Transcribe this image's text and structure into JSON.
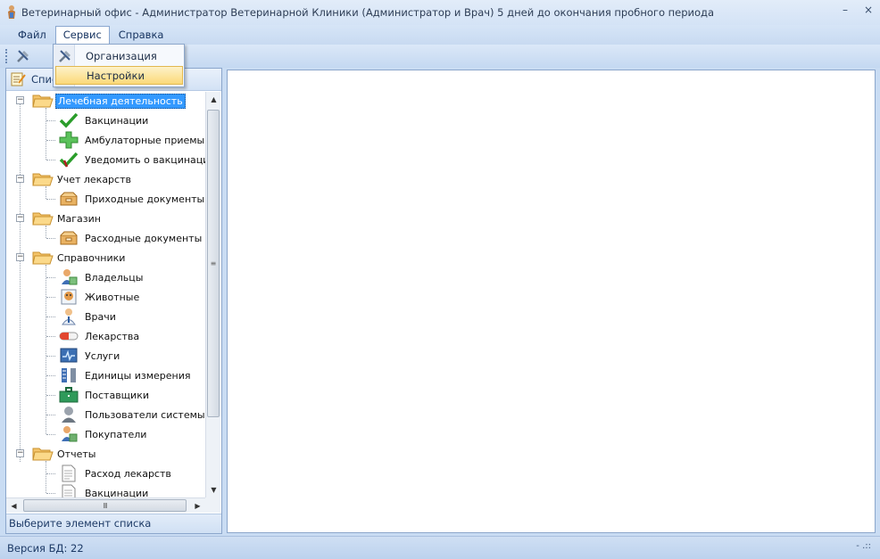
{
  "window": {
    "title": "Ветеринарный офис - Администратор Ветеринарной Клиники (Администратор и Врач) 5 дней до окончания пробного периода",
    "minimize": "–",
    "close": "×"
  },
  "menu": {
    "file": "Файл",
    "service": "Сервис",
    "help": "Справка"
  },
  "dropdown": {
    "items": [
      {
        "label": "Организация",
        "icon": "tools-icon"
      },
      {
        "label": "Настройки",
        "icon": "settings-icon"
      }
    ]
  },
  "left_panel": {
    "header": "Спис",
    "status": "Выберите элемент списка",
    "hscroll_grip": "III",
    "vscroll_grip": "≡"
  },
  "tree": {
    "groups": [
      {
        "label": "Лечебная деятельность",
        "selected": true,
        "children": [
          {
            "label": "Вакцинации",
            "icon": "checkmark-icon"
          },
          {
            "label": "Амбулаторные приемы",
            "icon": "medical-cross-icon"
          },
          {
            "label": "Уведомить о вакцинациях",
            "icon": "check-notify-icon"
          }
        ]
      },
      {
        "label": "Учет лекарств",
        "children": [
          {
            "label": "Приходные документы",
            "icon": "box-icon"
          }
        ]
      },
      {
        "label": "Магазин",
        "children": [
          {
            "label": "Расходные документы",
            "icon": "box-icon"
          }
        ]
      },
      {
        "label": "Справочники",
        "children": [
          {
            "label": "Владельцы",
            "icon": "owner-icon"
          },
          {
            "label": "Животные",
            "icon": "animal-icon"
          },
          {
            "label": "Врачи",
            "icon": "doctor-icon"
          },
          {
            "label": "Лекарства",
            "icon": "pill-icon"
          },
          {
            "label": "Услуги",
            "icon": "monitor-icon"
          },
          {
            "label": "Единицы измерения",
            "icon": "units-icon"
          },
          {
            "label": "Поставщики",
            "icon": "briefcase-icon"
          },
          {
            "label": "Пользователи системы",
            "icon": "user-icon"
          },
          {
            "label": "Покупатели",
            "icon": "buyer-icon"
          }
        ]
      },
      {
        "label": "Отчеты",
        "children": [
          {
            "label": "Расход лекарств",
            "icon": "document-icon"
          },
          {
            "label": "Вакцинации",
            "icon": "document-icon"
          }
        ]
      }
    ]
  },
  "statusbar": {
    "db_version": "Версия БД: 22",
    "right": "- .::"
  }
}
